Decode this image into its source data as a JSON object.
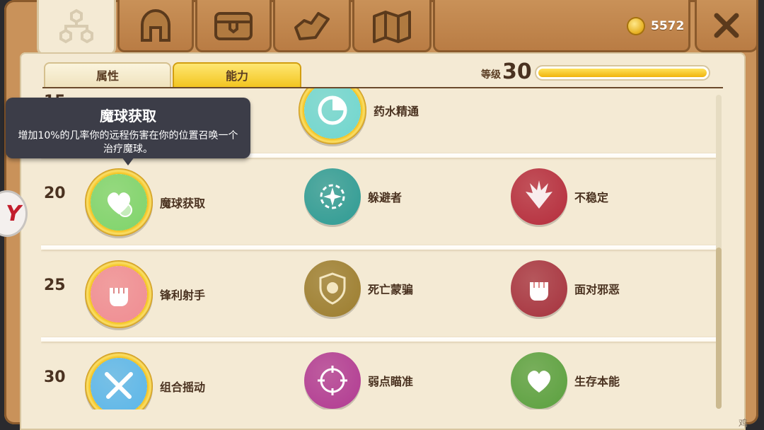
{
  "header": {
    "tabs": [
      {
        "name": "skill-tree-tab",
        "icon": "skill-tree-icon",
        "active": true
      },
      {
        "name": "helmet-tab",
        "icon": "helmet-icon",
        "active": false
      },
      {
        "name": "chest-tab",
        "icon": "treasure-chest-icon",
        "active": false
      },
      {
        "name": "gauntlet-tab",
        "icon": "gauntlet-icon",
        "active": false
      },
      {
        "name": "map-tab",
        "icon": "map-icon",
        "active": false
      }
    ],
    "coins": "5572",
    "close_icon": "close-icon"
  },
  "subtabs": {
    "attributes": "属性",
    "abilities": "能力",
    "active": "abilities"
  },
  "level": {
    "label": "等级",
    "value": "30",
    "progress": 0.99
  },
  "tooltip": {
    "title": "魔球获取",
    "description": "增加10%的几率你的远程伤害在你的位置召唤一个治疗魔球。"
  },
  "rows": [
    {
      "level": "15",
      "skills": [
        {
          "name": "药水精通",
          "icon": "clock-icon",
          "color": "#6fd6cf",
          "selected": true
        }
      ]
    },
    {
      "level": "20",
      "skills": [
        {
          "name": "魔球获取",
          "icon": "heart-orb-icon",
          "color": "#7ed46a",
          "selected": true
        },
        {
          "name": "躲避者",
          "icon": "dodge-icon",
          "color": "#2e9b94",
          "selected": false
        },
        {
          "name": "不稳定",
          "icon": "explosion-icon",
          "color": "#b52c3c",
          "selected": false
        }
      ]
    },
    {
      "level": "25",
      "skills": [
        {
          "name": "锋利射手",
          "icon": "fist-icon",
          "color": "#f08c92",
          "selected": true
        },
        {
          "name": "死亡蒙骗",
          "icon": "skull-shield-icon",
          "color": "#9c7d2e",
          "selected": false
        },
        {
          "name": "面对邪恶",
          "icon": "fist-icon",
          "color": "#a6323e",
          "selected": false
        }
      ]
    },
    {
      "level": "30",
      "skills": [
        {
          "name": "组合摇动",
          "icon": "crossed-swords-icon",
          "color": "#5ab6ea",
          "selected": true
        },
        {
          "name": "弱点瞄准",
          "icon": "crosshair-icon",
          "color": "#b13a92",
          "selected": false
        },
        {
          "name": "生存本能",
          "icon": "heart-icon",
          "color": "#5aa03e",
          "selected": false
        }
      ]
    }
  ],
  "side_badge": "Y",
  "watermark": "鸡"
}
